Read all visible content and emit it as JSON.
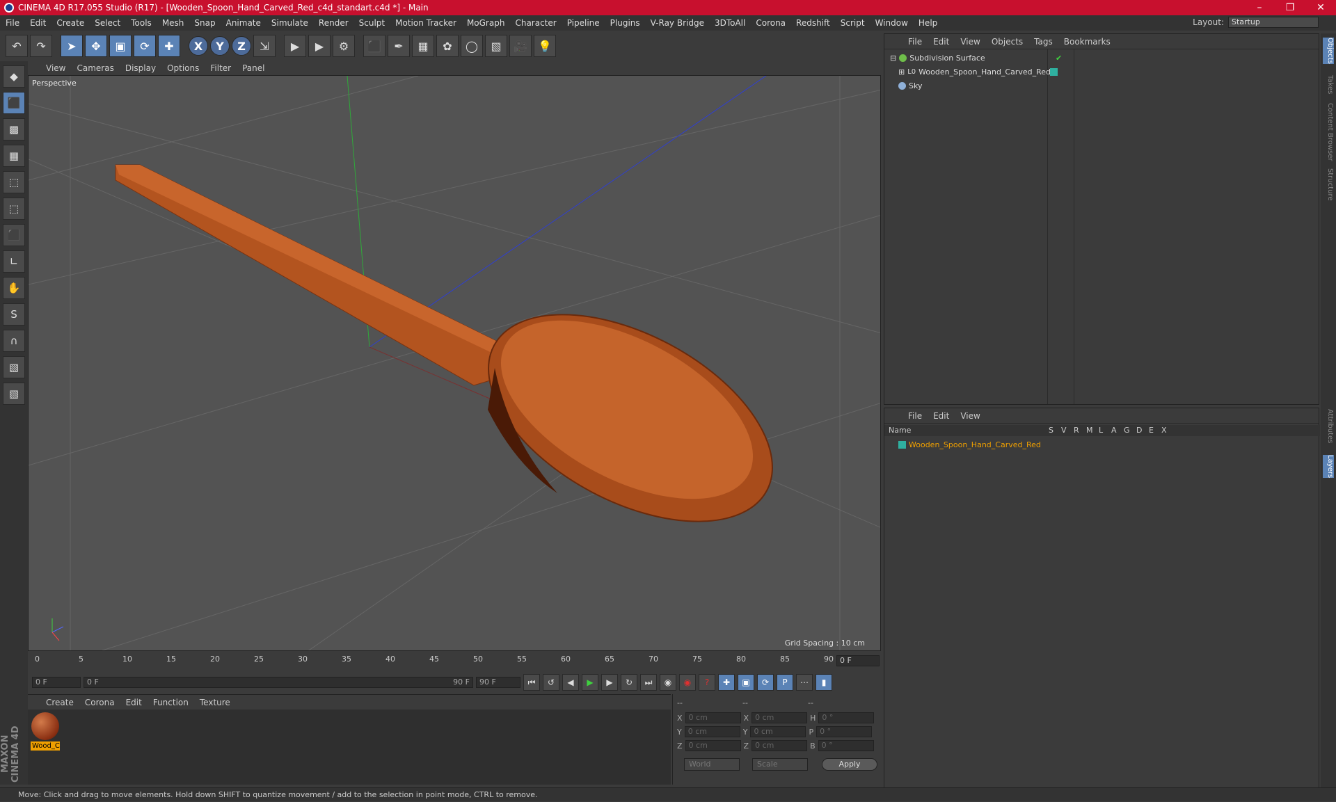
{
  "window": {
    "title": "CINEMA 4D R17.055 Studio (R17) - [Wooden_Spoon_Hand_Carved_Red_c4d_standart.c4d *] - Main"
  },
  "menu": [
    "File",
    "Edit",
    "Create",
    "Select",
    "Tools",
    "Mesh",
    "Snap",
    "Animate",
    "Simulate",
    "Render",
    "Sculpt",
    "Motion Tracker",
    "MoGraph",
    "Character",
    "Pipeline",
    "Plugins",
    "V-Ray Bridge",
    "3DToAll",
    "Corona",
    "Redshift",
    "Script",
    "Window",
    "Help"
  ],
  "layout": {
    "label": "Layout:",
    "value": "Startup"
  },
  "viewport": {
    "menu": [
      "View",
      "Cameras",
      "Display",
      "Options",
      "Filter",
      "Panel"
    ],
    "label": "Perspective",
    "grid_spacing": "Grid Spacing : 10 cm"
  },
  "timeline": {
    "ticks": [
      "0",
      "5",
      "10",
      "15",
      "20",
      "25",
      "30",
      "35",
      "40",
      "45",
      "50",
      "55",
      "60",
      "65",
      "70",
      "75",
      "80",
      "85",
      "90"
    ],
    "current_frame": "0 F",
    "start_field": "0 F",
    "range_start": "0 F",
    "range_end": "90 F",
    "end_field": "90 F"
  },
  "materials": {
    "menu": [
      "Create",
      "Corona",
      "Edit",
      "Function",
      "Texture"
    ],
    "items": [
      {
        "name": "Wood_C"
      }
    ]
  },
  "coords": {
    "headers": [
      "--",
      "--",
      "--"
    ],
    "rows": [
      {
        "a": "X",
        "v1": "0 cm",
        "b": "X",
        "v2": "0 cm",
        "c": "H",
        "v3": "0 °"
      },
      {
        "a": "Y",
        "v1": "0 cm",
        "b": "Y",
        "v2": "0 cm",
        "c": "P",
        "v3": "0 °"
      },
      {
        "a": "Z",
        "v1": "0 cm",
        "b": "Z",
        "v2": "0 cm",
        "c": "B",
        "v3": "0 °"
      }
    ],
    "mode": "World",
    "scale": "Scale",
    "apply": "Apply"
  },
  "objects": {
    "menu": [
      "File",
      "Edit",
      "View",
      "Objects",
      "Tags",
      "Bookmarks"
    ],
    "items": [
      {
        "name": "Subdivision Surface",
        "color": "#6fbf4a"
      },
      {
        "name": "Wooden_Spoon_Hand_Carved_Red",
        "color": "#2fb0a0"
      },
      {
        "name": "Sky",
        "color": "#8fb0d8"
      }
    ]
  },
  "layers": {
    "menu": [
      "File",
      "Edit",
      "View"
    ],
    "columns": [
      "Name",
      "S",
      "V",
      "R",
      "M",
      "L",
      "A",
      "G",
      "D",
      "E",
      "X"
    ],
    "items": [
      {
        "name": "Wooden_Spoon_Hand_Carved_Red",
        "color": "#2fb0a0"
      }
    ]
  },
  "right_tabs": [
    "Objects",
    "Takes",
    "Content Browser",
    "Structure",
    "Attributes",
    "Layers"
  ],
  "brand": "MAXON CINEMA 4D",
  "status": "Move: Click and drag to move elements. Hold down SHIFT to quantize movement / add to the selection in point mode, CTRL to remove."
}
